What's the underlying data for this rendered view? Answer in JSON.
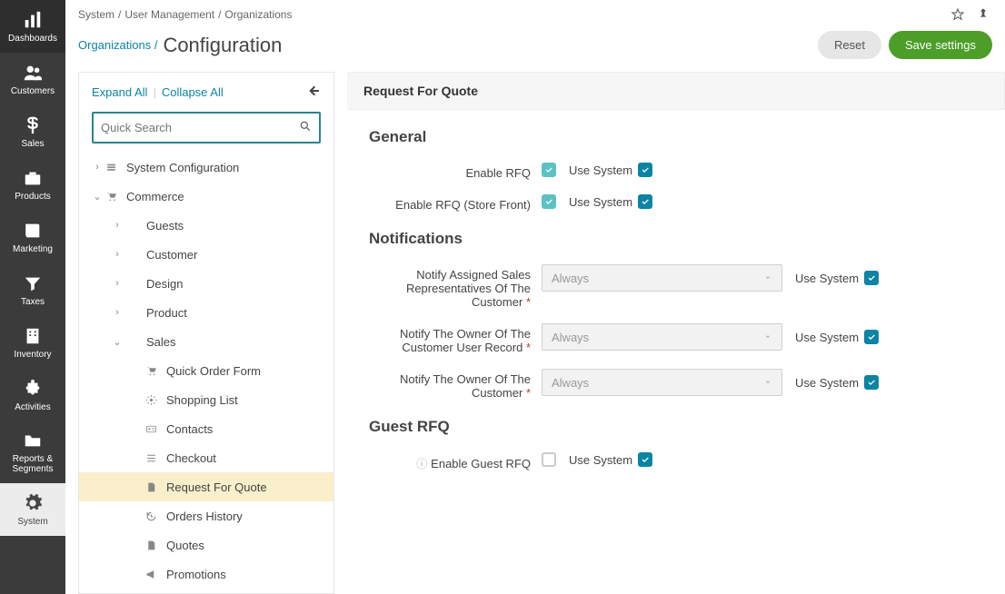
{
  "nav": [
    {
      "id": "dashboards",
      "label": "Dashboards"
    },
    {
      "id": "customers",
      "label": "Customers"
    },
    {
      "id": "sales",
      "label": "Sales"
    },
    {
      "id": "products",
      "label": "Products"
    },
    {
      "id": "marketing",
      "label": "Marketing"
    },
    {
      "id": "taxes",
      "label": "Taxes"
    },
    {
      "id": "inventory",
      "label": "Inventory"
    },
    {
      "id": "activities",
      "label": "Activities"
    },
    {
      "id": "reports",
      "label": "Reports & Segments"
    },
    {
      "id": "system",
      "label": "System",
      "active": true
    }
  ],
  "breadcrumb": {
    "a": "System",
    "b": "User Management",
    "c": "Organizations"
  },
  "titleBreadcrumb": "Organizations /",
  "pageTitle": "Configuration",
  "buttons": {
    "reset": "Reset",
    "save": "Save settings"
  },
  "tree": {
    "expandAll": "Expand All",
    "collapseAll": "Collapse All",
    "searchPlaceholder": "Quick Search",
    "items": [
      {
        "depth": 0,
        "caret": "right",
        "icon": "cog-stack",
        "label": "System Configuration"
      },
      {
        "depth": 0,
        "caret": "down",
        "icon": "cart",
        "label": "Commerce"
      },
      {
        "depth": 1,
        "caret": "right",
        "icon": "",
        "label": "Guests"
      },
      {
        "depth": 1,
        "caret": "right",
        "icon": "",
        "label": "Customer"
      },
      {
        "depth": 1,
        "caret": "right",
        "icon": "",
        "label": "Design"
      },
      {
        "depth": 1,
        "caret": "right",
        "icon": "",
        "label": "Product"
      },
      {
        "depth": 1,
        "caret": "down",
        "icon": "",
        "label": "Sales"
      },
      {
        "depth": 2,
        "icon": "cart",
        "label": "Quick Order Form"
      },
      {
        "depth": 2,
        "icon": "gear",
        "label": "Shopping List"
      },
      {
        "depth": 2,
        "icon": "card",
        "label": "Contacts"
      },
      {
        "depth": 2,
        "icon": "list",
        "label": "Checkout"
      },
      {
        "depth": 2,
        "icon": "file",
        "label": "Request For Quote",
        "active": true
      },
      {
        "depth": 2,
        "icon": "history",
        "label": "Orders History"
      },
      {
        "depth": 2,
        "icon": "file",
        "label": "Quotes"
      },
      {
        "depth": 2,
        "icon": "megaphone",
        "label": "Promotions"
      }
    ]
  },
  "form": {
    "panelTitle": "Request For Quote",
    "sections": {
      "general": {
        "title": "General",
        "rows": [
          {
            "label": "Enable RFQ",
            "chkTeal": true,
            "useSystem": "Use System"
          },
          {
            "label": "Enable RFQ (Store Front)",
            "chkTeal": true,
            "useSystem": "Use System"
          }
        ]
      },
      "notifications": {
        "title": "Notifications",
        "rows": [
          {
            "label": "Notify Assigned Sales Representatives Of The Customer",
            "required": true,
            "select": "Always",
            "useSystem": "Use System"
          },
          {
            "label": "Notify The Owner Of The Customer User Record",
            "required": true,
            "select": "Always",
            "useSystem": "Use System"
          },
          {
            "label": "Notify The Owner Of The Customer",
            "required": true,
            "select": "Always",
            "useSystem": "Use System"
          }
        ]
      },
      "guest": {
        "title": "Guest RFQ",
        "rows": [
          {
            "label": "Enable Guest RFQ",
            "info": true,
            "chkEmpty": true,
            "useSystem": "Use System"
          }
        ]
      }
    }
  }
}
